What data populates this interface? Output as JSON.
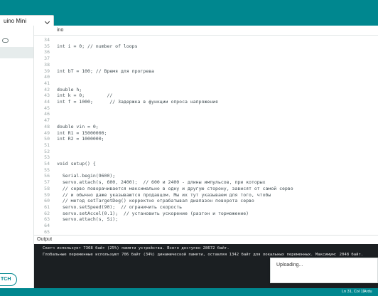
{
  "header": {
    "board_selector": "uino Mini"
  },
  "tabs": [
    {
      "label": "ino"
    }
  ],
  "editor": {
    "lines": [
      {
        "num": "34",
        "text": ""
      },
      {
        "num": "35",
        "text": "int i = 0; // number of loops"
      },
      {
        "num": "36",
        "text": ""
      },
      {
        "num": "37",
        "text": ""
      },
      {
        "num": "38",
        "text": ""
      },
      {
        "num": "39",
        "text": "int bT = 100; // Время для прогрева"
      },
      {
        "num": "40",
        "text": ""
      },
      {
        "num": "41",
        "text": ""
      },
      {
        "num": "42",
        "text": "double h;"
      },
      {
        "num": "43",
        "text": "int k = 0;        //"
      },
      {
        "num": "44",
        "text": "int f = 1000;      // Задержка в функции опроса напряжения"
      },
      {
        "num": "45",
        "text": ""
      },
      {
        "num": "46",
        "text": ""
      },
      {
        "num": "47",
        "text": ""
      },
      {
        "num": "48",
        "text": "double vin = 0;"
      },
      {
        "num": "49",
        "text": "int R1 = 15000000;"
      },
      {
        "num": "50",
        "text": "int R2 = 1000000;"
      },
      {
        "num": "51",
        "text": ""
      },
      {
        "num": "52",
        "text": ""
      },
      {
        "num": "53",
        "text": ""
      },
      {
        "num": "54",
        "text": "void setup() {"
      },
      {
        "num": "55",
        "text": ""
      },
      {
        "num": "56",
        "text": "  Serial.begin(9600);"
      },
      {
        "num": "57",
        "text": "  servo.attach(s, 600, 2400);  // 600 и 2400 - длины импульсов, при которых"
      },
      {
        "num": "58",
        "text": "  // серво поворачивается максимально в одну и другую сторону, зависят от самой серво"
      },
      {
        "num": "59",
        "text": "  // и обычно даже указываются продавцом. Мы их тут указываем для того, чтобы"
      },
      {
        "num": "60",
        "text": "  // метод setTargetDeg() корректно отрабатывал диапазон поворота серво"
      },
      {
        "num": "61",
        "text": "  servo.setSpeed(90);  // ограничить скорость"
      },
      {
        "num": "62",
        "text": "  servo.setAccel(0.1);  // установить ускорение (разгон и торможение)"
      },
      {
        "num": "63",
        "text": "  servo.attach(s, Si);"
      },
      {
        "num": "64",
        "text": ""
      },
      {
        "num": "65",
        "text": ""
      }
    ]
  },
  "output": {
    "label": "Output",
    "lines": [
      "Скетч использует 7368 байт (25%) памяти устройства. Всего доступно 28672 байт.",
      "Глобальные переменные используют 706 байт (34%) динамической памяти, оставляя 1342 байт для локальных переменных. Максимум: 2048 байт."
    ]
  },
  "toast": {
    "text": "Uploading..."
  },
  "sidebar": {
    "upload_button_label": "TCH"
  },
  "status": {
    "cursor_position": "Ln 31, Col 11",
    "board": "Ardu"
  },
  "colors": {
    "accent": "#00878f",
    "console_bg": "#1b1f22"
  }
}
